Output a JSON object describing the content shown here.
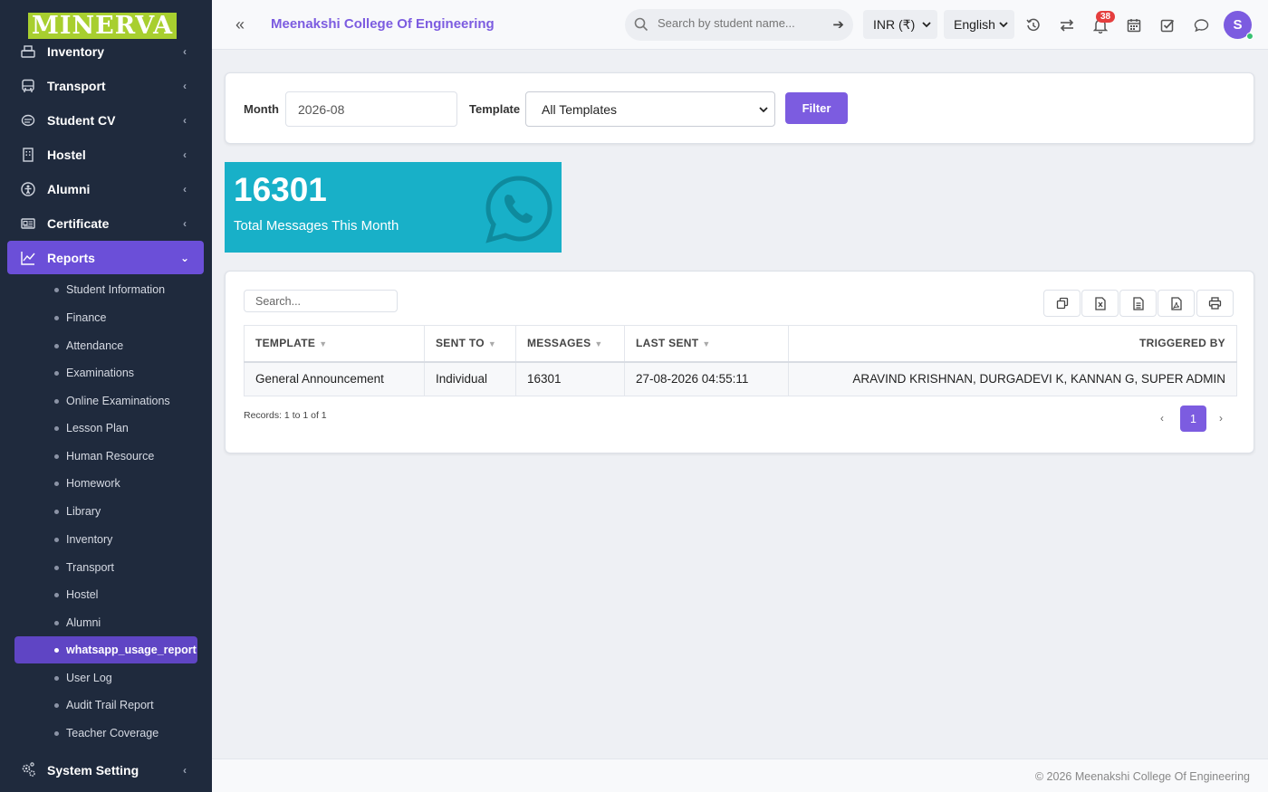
{
  "brand": {
    "logo_text": "MINERVA"
  },
  "sidebar": {
    "menu": [
      {
        "label": "Inventory",
        "icon": "inventory-icon"
      },
      {
        "label": "Transport",
        "icon": "bus-icon"
      },
      {
        "label": "Student CV",
        "icon": "cv-icon"
      },
      {
        "label": "Hostel",
        "icon": "building-icon"
      },
      {
        "label": "Alumni",
        "icon": "alumni-icon"
      },
      {
        "label": "Certificate",
        "icon": "certificate-icon"
      },
      {
        "label": "Reports",
        "icon": "chart-line-icon",
        "active": true
      }
    ],
    "sub_items": [
      "Student Information",
      "Finance",
      "Attendance",
      "Examinations",
      "Online Examinations",
      "Lesson Plan",
      "Human Resource",
      "Homework",
      "Library",
      "Inventory",
      "Transport",
      "Hostel",
      "Alumni",
      "whatsapp_usage_report",
      "User Log",
      "Audit Trail Report",
      "Teacher Coverage"
    ],
    "active_sub": "whatsapp_usage_report",
    "bottom": {
      "label": "System Setting",
      "icon": "gears-icon"
    }
  },
  "header": {
    "college_name": "Meenakshi College Of Engineering",
    "search_placeholder": "Search by student name...",
    "currency": "INR (₹)",
    "language": "English",
    "notification_count": "38",
    "avatar_initial": "S"
  },
  "filter": {
    "month_label": "Month",
    "month_value": "2026-08",
    "template_label": "Template",
    "template_value": "All Templates",
    "button": "Filter"
  },
  "stat": {
    "value": "16301",
    "label": "Total Messages This Month",
    "color": "#18b0c8",
    "icon": "whatsapp-icon"
  },
  "table": {
    "search_placeholder": "Search...",
    "columns": [
      "TEMPLATE",
      "SENT TO",
      "MESSAGES",
      "LAST SENT",
      "TRIGGERED BY"
    ],
    "rows": [
      [
        "General Announcement",
        "Individual",
        "16301",
        "27-08-2026 04:55:11",
        "ARAVIND KRISHNAN, DURGADEVI K, KANNAN G, SUPER ADMIN"
      ]
    ],
    "records_text": "Records: 1 to 1 of 1",
    "current_page": "1"
  },
  "footer": {
    "text": "© 2026 Meenakshi College Of Engineering"
  },
  "colors": {
    "accent": "#7c5ce0",
    "sidebar_bg": "#1f2a3d",
    "stat_bg": "#18b0c8"
  }
}
